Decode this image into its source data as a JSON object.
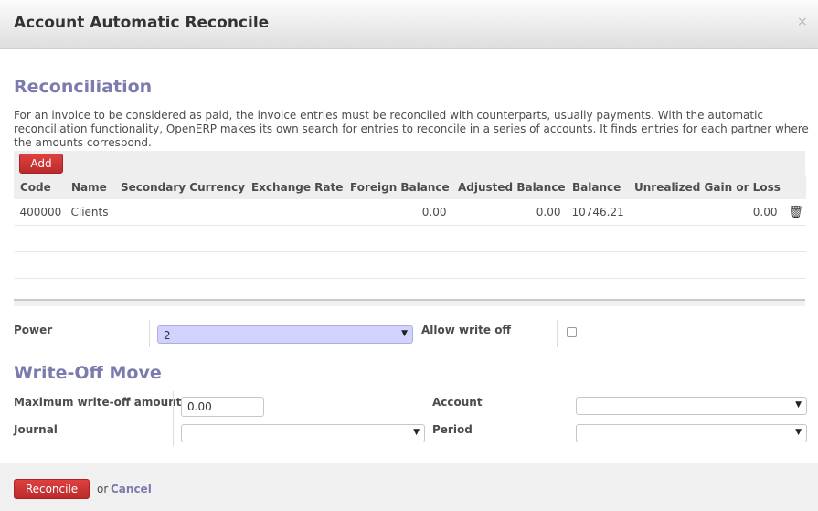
{
  "dialog": {
    "title": "Account Automatic Reconcile",
    "close": "×"
  },
  "reconciliation": {
    "title": "Reconciliation",
    "help": "For an invoice to be considered as paid, the invoice entries must be reconciled with counterparts, usually payments. With the automatic reconciliation functionality, OpenERP makes its own search for entries to reconcile in a series of accounts. It finds entries for each partner where the amounts correspond."
  },
  "accounts_table": {
    "add_label": "Add",
    "columns": [
      "Code",
      "Name",
      "Secondary Currency",
      "Exchange Rate",
      "Foreign Balance",
      "Adjusted Balance",
      "Balance",
      "Unrealized Gain or Loss"
    ],
    "rows": [
      {
        "code": "400000",
        "name": "Clients",
        "secondary_currency": "",
        "exchange_rate": "",
        "foreign_balance": "0.00",
        "adjusted_balance": "0.00",
        "balance": "10746.21",
        "unrealized_gain_or_loss": "0.00",
        "delete_icon": "trash-icon"
      }
    ]
  },
  "options": {
    "power_label": "Power",
    "power_value": "2",
    "allow_write_off_label": "Allow write off",
    "allow_write_off_checked": false
  },
  "write_off": {
    "title": "Write-Off Move",
    "max_amount_label": "Maximum write-off amount",
    "max_amount_value": "0.00",
    "account_label": "Account",
    "account_value": "",
    "journal_label": "Journal",
    "journal_value": "",
    "period_label": "Period",
    "period_value": ""
  },
  "footer": {
    "reconcile_label": "Reconcile",
    "or_text": "or",
    "cancel_label": "Cancel"
  },
  "colors": {
    "accent": "#7c7bad",
    "primary_button": "#c9302c",
    "power_field": "#d2d2ff"
  }
}
